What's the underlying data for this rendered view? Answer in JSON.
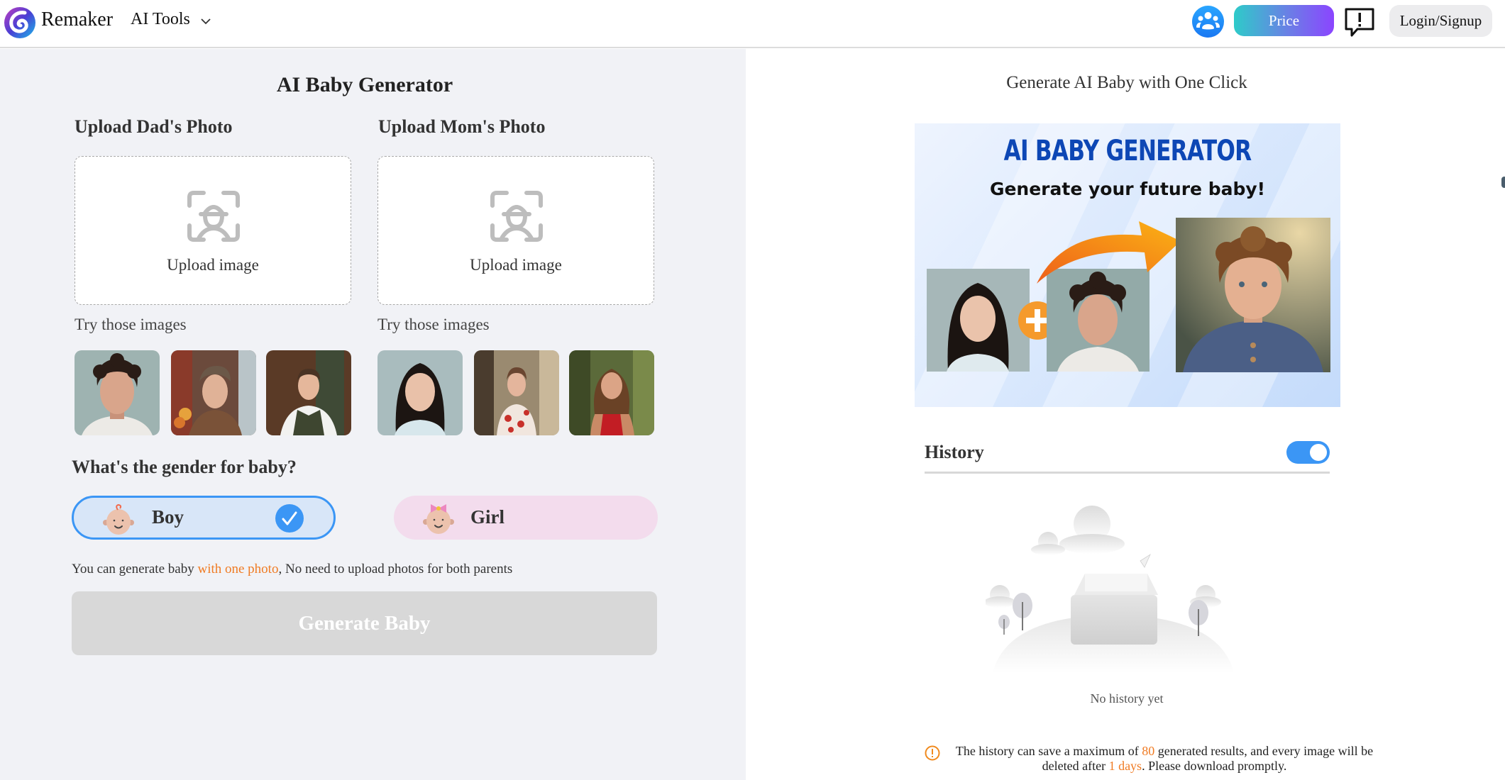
{
  "header": {
    "brand": "Remaker",
    "menu_label": "AI Tools",
    "price_label": "Price",
    "login_label": "Login/Signup",
    "icons": {
      "logo": "remaker-logo-icon",
      "menu_chevron": "chevron-down-icon",
      "community": "people-icon",
      "feedback": "feedback-exclamation-icon"
    }
  },
  "left": {
    "title": "AI Baby Generator",
    "dad": {
      "label": "Upload Dad's Photo",
      "upload_text": "Upload image",
      "try_label": "Try those images",
      "samples": [
        "Curly-haired man portrait",
        "Man in flat cap on street",
        "Smiling man in vest"
      ]
    },
    "mom": {
      "label": "Upload Mom's Photo",
      "upload_text": "Upload image",
      "try_label": "Try those images",
      "samples": [
        "Asian woman portrait",
        "Woman in floral dress",
        "Woman in red top"
      ]
    },
    "gender": {
      "question": "What's the gender for baby?",
      "options": [
        {
          "label": "Boy",
          "selected": true
        },
        {
          "label": "Girl",
          "selected": false
        }
      ]
    },
    "hint": {
      "before": "You can generate baby ",
      "highlight": "with one photo",
      "after": ", No need to upload photos for both parents"
    },
    "generate_label": "Generate Baby"
  },
  "right": {
    "title": "Generate AI Baby with One Click",
    "banner": {
      "heading": "AI BABY GENERATOR",
      "subheading": "Generate your future baby!"
    },
    "history": {
      "label": "History",
      "toggle_on": true,
      "empty_text": "No history yet"
    },
    "note": {
      "part1": "The history can save a maximum of ",
      "max_results": "80",
      "part2": " generated results, and every image will be deleted after ",
      "days": "1 days",
      "part3": ". Please download promptly."
    }
  },
  "colors": {
    "accent_blue": "#3b96f5",
    "highlight_orange": "#f07b23",
    "left_bg": "#f1f2f6",
    "girl_pill": "#f3dced",
    "boy_pill": "#d8e6f8",
    "generate_disabled": "#d8d8d8"
  }
}
